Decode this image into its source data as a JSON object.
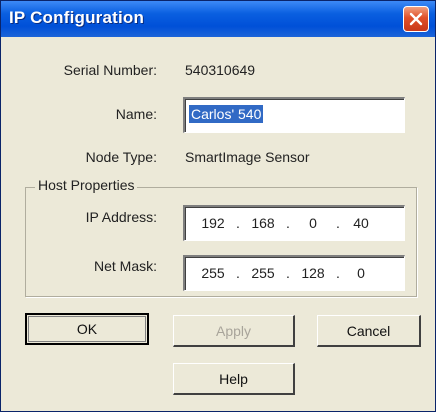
{
  "window": {
    "title": "IP Configuration",
    "close_icon": "close-icon"
  },
  "fields": {
    "serial_label": "Serial Number:",
    "serial_value": "540310649",
    "name_label": "Name:",
    "name_value": "Carlos' 540",
    "node_type_label": "Node Type:",
    "node_type_value": "SmartImage Sensor"
  },
  "host_properties": {
    "title": "Host Properties",
    "ip_label": "IP Address:",
    "ip": [
      "192",
      "168",
      "0",
      "40"
    ],
    "mask_label": "Net Mask:",
    "mask": [
      "255",
      "255",
      "128",
      "0"
    ]
  },
  "buttons": {
    "ok": "OK",
    "apply": "Apply",
    "cancel": "Cancel",
    "help": "Help"
  },
  "colors": {
    "title_bar": "#0054e3",
    "dialog_bg": "#ece9d8",
    "selection": "#316ac5",
    "close_button": "#e0502a"
  }
}
